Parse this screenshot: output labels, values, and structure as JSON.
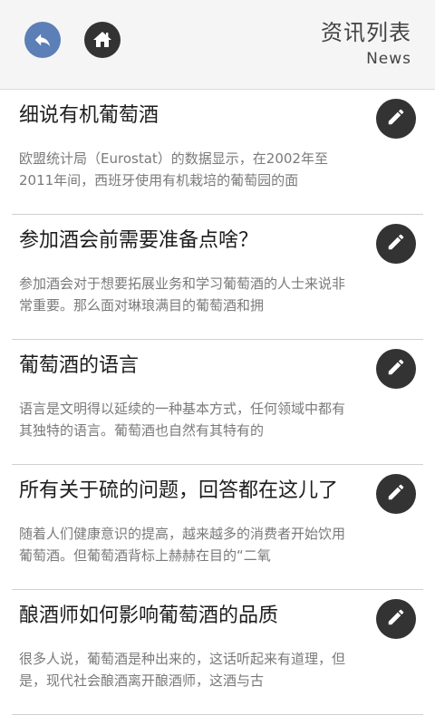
{
  "header": {
    "title": "资讯列表",
    "subtitle": "News",
    "back_icon": "back-arrow-icon",
    "home_icon": "home-icon",
    "back_color": "#5b7fb6",
    "home_color": "#333333"
  },
  "articles": [
    {
      "title": "细说有机葡萄酒",
      "summary": "欧盟统计局（Eurostat）的数据显示，在2002年至2011年间，西班牙使用有机栽培的葡萄园的面"
    },
    {
      "title": "参加酒会前需要准备点啥？",
      "summary": "参加酒会对于想要拓展业务和学习葡萄酒的人士来说非常重要。那么面对琳琅满目的葡萄酒和拥"
    },
    {
      "title": "葡萄酒的语言",
      "summary": "语言是文明得以延续的一种基本方式，任何领域中都有其独特的语言。葡萄酒也自然有其特有的"
    },
    {
      "title": "所有关于硫的问题，回答都在这儿了",
      "summary": "随着人们健康意识的提高，越来越多的消费者开始饮用葡萄酒。但葡萄酒背标上赫赫在目的“二氧"
    },
    {
      "title": "酿酒师如何影响葡萄酒的品质",
      "summary": "很多人说，葡萄酒是种出来的，这话听起来有道理，但是，现代社会酿酒离开酿酒师，这酒与古"
    }
  ],
  "edit_icon": "pencil-icon",
  "edit_color": "#333333"
}
